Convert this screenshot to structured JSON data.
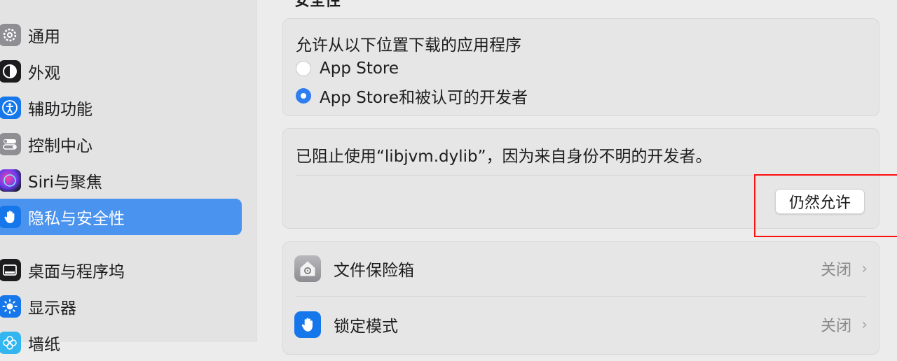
{
  "sidebar": {
    "items": [
      {
        "label": "通用",
        "icon": "gear-icon"
      },
      {
        "label": "外观",
        "icon": "appearance-icon"
      },
      {
        "label": "辅助功能",
        "icon": "accessibility-icon"
      },
      {
        "label": "控制中心",
        "icon": "control-center-icon"
      },
      {
        "label": "Siri与聚焦",
        "icon": "siri-icon"
      },
      {
        "label": "隐私与安全性",
        "icon": "hand-icon",
        "selected": true
      },
      {
        "label": "桌面与程序坞",
        "icon": "dock-icon"
      },
      {
        "label": "显示器",
        "icon": "sun-icon"
      },
      {
        "label": "墙纸",
        "icon": "wallpaper-icon"
      }
    ]
  },
  "main": {
    "section_heading": "安全性",
    "downloads": {
      "title": "允许从以下位置下载的应用程序",
      "options": [
        "App Store",
        "App Store和被认可的开发者"
      ],
      "selected_index": 1
    },
    "blocked": {
      "message": "已阻止使用“libjvm.dylib”，因为来自身份不明的开发者。",
      "allow_button": "仍然允许"
    },
    "settings": [
      {
        "label": "文件保险箱",
        "value": "关闭",
        "icon": "filevault-icon"
      },
      {
        "label": "锁定模式",
        "value": "关闭",
        "icon": "lockdown-hand-icon"
      }
    ]
  },
  "colors": {
    "accent": "#2f7ef1",
    "selection": "#4a93ee",
    "highlight_annotation": "#ff0f0f"
  }
}
